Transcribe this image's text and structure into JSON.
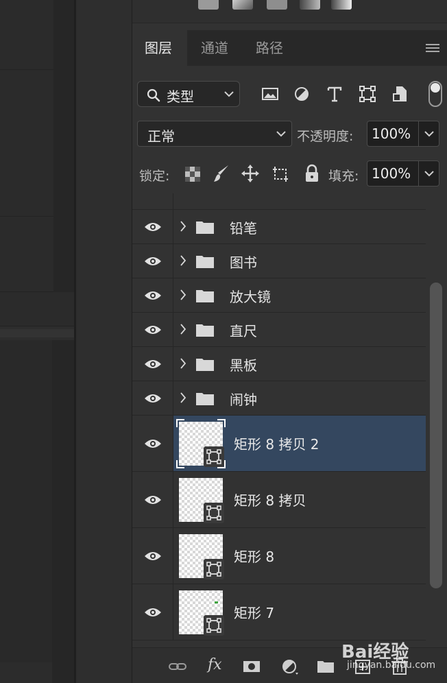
{
  "tabs": [
    {
      "label": "图层",
      "active": true
    },
    {
      "label": "通道",
      "active": false
    },
    {
      "label": "路径",
      "active": false
    }
  ],
  "filter": {
    "label": "类型",
    "icons": [
      "image-filter-icon",
      "adjustment-filter-icon",
      "type-filter-icon",
      "shape-filter-icon",
      "smart-object-filter-icon"
    ]
  },
  "blend_mode": {
    "value": "正常"
  },
  "opacity": {
    "label": "不透明度:",
    "value": "100%"
  },
  "lock": {
    "label": "锁定:",
    "icons": [
      "lock-transparent-pixels-icon",
      "lock-image-pixels-icon",
      "lock-position-icon",
      "lock-artboard-icon",
      "lock-all-icon"
    ]
  },
  "fill": {
    "label": "填充:",
    "value": "100%"
  },
  "layers": [
    {
      "kind": "group",
      "name": "铅笔"
    },
    {
      "kind": "group",
      "name": "图书"
    },
    {
      "kind": "group",
      "name": "放大镜"
    },
    {
      "kind": "group",
      "name": "直尺"
    },
    {
      "kind": "group",
      "name": "黑板"
    },
    {
      "kind": "group",
      "name": "闹钟"
    },
    {
      "kind": "shape",
      "name": "矩形 8 拷贝 2",
      "selected": true
    },
    {
      "kind": "shape",
      "name": "矩形 8 拷贝",
      "selected": false
    },
    {
      "kind": "shape",
      "name": "矩形 8",
      "selected": false
    },
    {
      "kind": "shape",
      "name": "矩形 7",
      "selected": false
    }
  ],
  "bottom_bar": {
    "fx_label": "fx"
  },
  "watermark": {
    "main": "Bai经验",
    "sub": "jingyan.baidu.com"
  },
  "colors": {
    "selected_row": "#34475f",
    "panel_bg": "#323232",
    "accent_text": "#e8e8e8"
  }
}
